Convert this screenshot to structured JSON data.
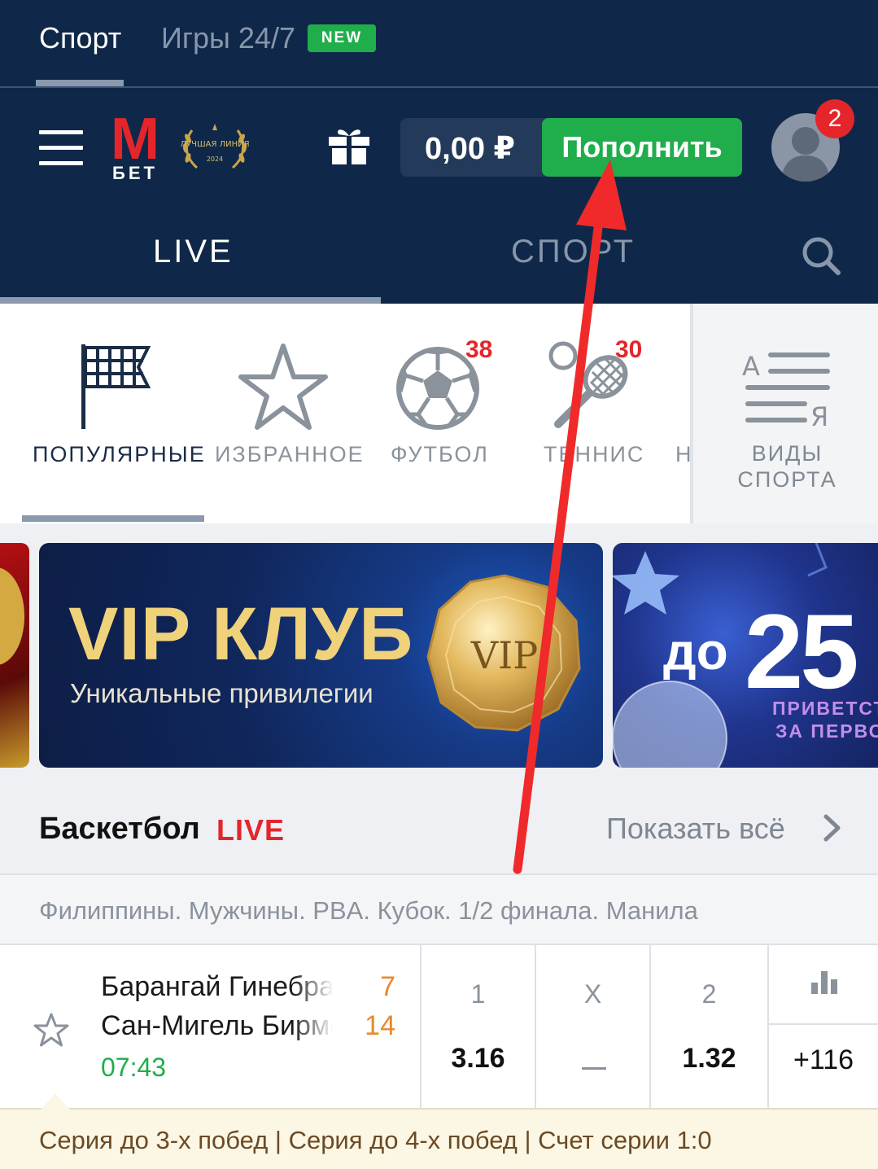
{
  "top_tabs": {
    "sport": "Спорт",
    "games": "Игры 24/7",
    "new_badge": "NEW"
  },
  "header": {
    "logo_letter": "M",
    "logo_word": "БЕТ",
    "award_text": "ЛУЧШАЯ ЛИНИЯ",
    "award_year": "2024",
    "balance": "0,00 ₽",
    "deposit_label": "Пополнить",
    "notifications_count": "2"
  },
  "mode_tabs": {
    "live": "LIVE",
    "sport": "СПОРТ"
  },
  "sports": {
    "items": [
      {
        "label": "ПОПУЛЯРНЫЕ",
        "count": ""
      },
      {
        "label": "ИЗБРАННОЕ",
        "count": ""
      },
      {
        "label": "ФУТБОЛ",
        "count": "38"
      },
      {
        "label": "ТЕННИС",
        "count": "30"
      },
      {
        "label": "Н",
        "count": ""
      }
    ],
    "kinds_label_line1": "ВИДЫ",
    "kinds_label_line2": "СПОРТА",
    "kinds_letter_a": "А",
    "kinds_letter_ya": "Я"
  },
  "banners": {
    "vip_title": "VIP КЛУБ",
    "vip_subtitle": "Уникальные привилегии",
    "vip_coin_text": "VIP",
    "promo_prefix": "до",
    "promo_number": "25",
    "promo_line1": "ПРИВЕТСТВ",
    "promo_line2": "ЗА ПЕРВОЕ"
  },
  "section": {
    "title": "Баскетбол",
    "live_label": "LIVE",
    "show_all": "Показать всё"
  },
  "league": "Филиппины. Мужчины. PBA. Кубок. 1/2 финала. Манила",
  "match": {
    "team1": "Барангай Гинебра",
    "team2": "Сан-Мигель Бирмен",
    "score1": "7",
    "score2": "14",
    "time": "07:43",
    "odds": [
      {
        "head": "1",
        "value": "3.16"
      },
      {
        "head": "X",
        "value": ""
      },
      {
        "head": "2",
        "value": "1.32"
      }
    ],
    "more_markets": "+116"
  },
  "series_info": "Серия до 3-х побед | Серия до 4-х побед | Счет серии 1:0",
  "colors": {
    "navy": "#0f2849",
    "green": "#1fae4b",
    "red": "#e4262b",
    "score_orange": "#e8892a"
  }
}
